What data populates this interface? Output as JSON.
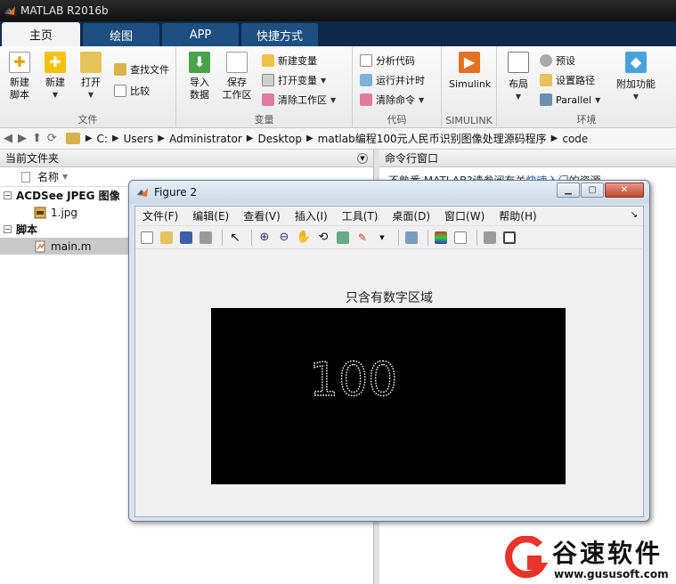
{
  "app": {
    "title": "MATLAB R2016b"
  },
  "tabs": [
    {
      "label": "主页",
      "active": true
    },
    {
      "label": "绘图"
    },
    {
      "label": "APP"
    },
    {
      "label": "快捷方式"
    }
  ],
  "ribbon": {
    "file": {
      "label": "文件",
      "new_script": "新建\n脚本",
      "new": "新建",
      "open": "打开",
      "find_files": "查找文件",
      "compare": "比较"
    },
    "variable": {
      "label": "变量",
      "import_data": "导入\n数据",
      "save_workspace": "保存\n工作区",
      "new_variable": "新建变量",
      "open_variable": "打开变量",
      "clear_workspace": "清除工作区"
    },
    "code": {
      "label": "代码",
      "analyze_code": "分析代码",
      "run_and_time": "运行并计时",
      "clear_commands": "清除命令"
    },
    "simulink": {
      "label": "SIMULINK",
      "simulink": "Simulink"
    },
    "environment": {
      "label": "环境",
      "layout": "布局",
      "preferences": "预设",
      "set_path": "设置路径",
      "parallel": "Parallel",
      "addons": "附加功能"
    }
  },
  "address": {
    "segments": [
      "C:",
      "Users",
      "Administrator",
      "Desktop",
      "matlab编程100元人民币识别图像处理源码程序",
      "code"
    ]
  },
  "current_folder": {
    "title": "当前文件夹",
    "column_name": "名称",
    "groups": [
      {
        "label": "ACDSee JPEG 图像",
        "files": [
          {
            "name": "1.jpg",
            "selected": false
          }
        ]
      },
      {
        "label": "脚本",
        "files": [
          {
            "name": "main.m",
            "selected": true
          }
        ]
      }
    ]
  },
  "command_window": {
    "title": "命令行窗口",
    "line_prefix": "不熟悉 MATLAB?请参阅有关",
    "link": "快速入门",
    "line_suffix": "的资源。"
  },
  "figure": {
    "title": "Figure 2",
    "menu": [
      "文件(F)",
      "编辑(E)",
      "查看(V)",
      "插入(I)",
      "工具(T)",
      "桌面(D)",
      "窗口(W)",
      "帮助(H)"
    ],
    "plot_title": "只含有数字区域",
    "image_text": "100"
  },
  "watermark": {
    "name": "谷速软件",
    "url": "www.gususoft.com"
  },
  "colors": {
    "tab_bar": "#0e2a4a",
    "tab": "#1d4f80",
    "watermark_red": "#e8342a"
  }
}
